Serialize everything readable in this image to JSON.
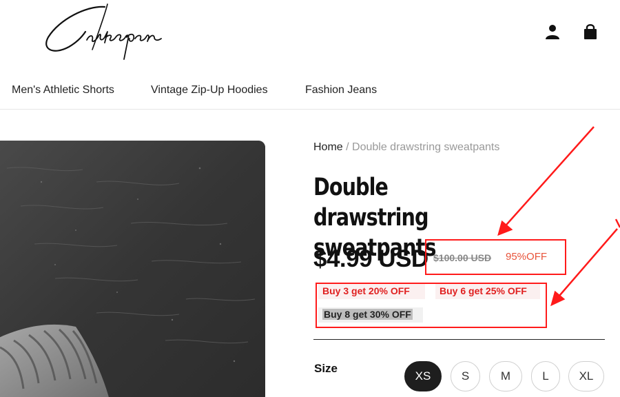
{
  "header": {
    "logo_text": "Cakespen",
    "icons": [
      "user-icon",
      "bag-icon"
    ]
  },
  "nav": {
    "items": [
      "Men's Athletic Shorts",
      "Vintage Zip-Up Hoodies",
      "Fashion Jeans"
    ]
  },
  "breadcrumb": {
    "home": "Home",
    "separator": " / ",
    "current": "Double drawstring sweatpants"
  },
  "product": {
    "title": "Double drawstring sweatpants",
    "price": "$4.99 USD",
    "compare_price": "$100.00 USD",
    "discount": "95%OFF",
    "promotions": [
      "Buy 3 get 20% OFF",
      "Buy 6 get 25% OFF",
      "Buy 8 get 30% OFF"
    ],
    "size_label": "Size",
    "sizes": [
      "XS",
      "S",
      "M",
      "L",
      "XL"
    ],
    "selected_size": "XS"
  },
  "colors": {
    "discount": "#e8533a",
    "promo_text": "#e02020",
    "annotation": "#ff1a1a",
    "selected_size_bg": "#1e1e1e"
  }
}
